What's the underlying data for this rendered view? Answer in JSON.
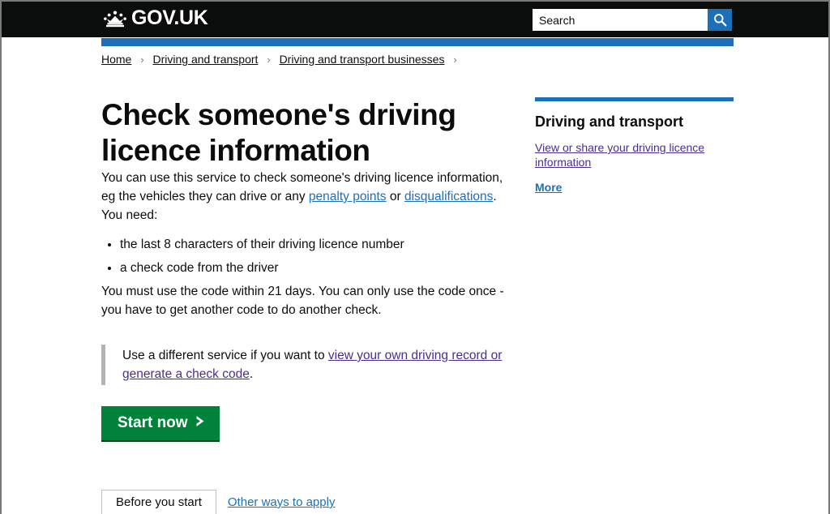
{
  "header": {
    "logo_text": "GOV.UK",
    "crown_icon": "crown-icon",
    "search": {
      "value": "Search",
      "placeholder": "Search",
      "button_icon": "search-icon",
      "button_label": "Search"
    }
  },
  "breadcrumbs": [
    {
      "label": "Home"
    },
    {
      "label": "Driving and transport"
    },
    {
      "label": "Driving and transport businesses"
    }
  ],
  "breadcrumb_separator": "›",
  "main": {
    "title": "Check someone's driving licence information",
    "intro_before_link1": "You can use this service to check someone's driving licence information, eg the vehicles they can drive or any ",
    "intro_link1": "penalty points",
    "intro_between_links": " or ",
    "intro_link2": "disqualifications",
    "intro_after_link2": ".",
    "need_label": "You need:",
    "need_items": [
      "the last 8 characters of their driving licence number",
      "a check code from the driver"
    ],
    "rule_text": "You must use the code within 21 days. You can only use the code once - you have to get another code to do another check.",
    "inset_before_link": "Use a different service if you want to ",
    "inset_link": "view your own driving record or generate a check code",
    "inset_after_link": ".",
    "start_button_label": "Start now",
    "start_button_icon": "chevron-right-icon"
  },
  "sidebar": {
    "title": "Driving and transport",
    "links": [
      {
        "label": "View or share your driving licence information"
      }
    ],
    "more_label": "More"
  },
  "tabs": [
    {
      "label": "Before you start",
      "active": true
    },
    {
      "label": "Other ways to apply",
      "active": false
    }
  ],
  "colors": {
    "header_black": "#0b0c0c",
    "govuk_blue": "#1d70b8",
    "link_blue": "#1d70b8",
    "link_visited_purple": "#4c2c92",
    "button_green": "#00823b",
    "inset_grey": "#b1b4b6"
  }
}
